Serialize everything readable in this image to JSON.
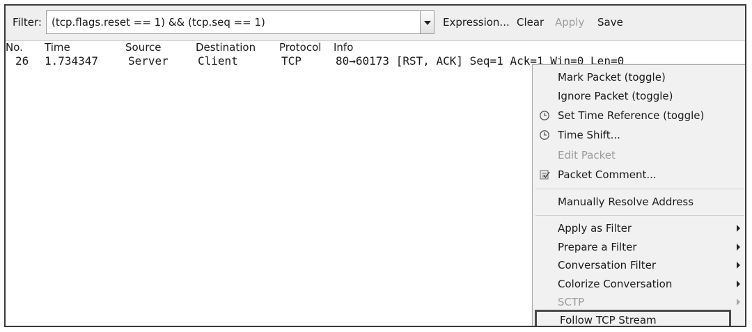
{
  "filter_bar": {
    "label": "Filter:",
    "value": "(tcp.flags.reset == 1) && (tcp.seq == 1)",
    "expression_button": "Expression...",
    "clear_button": "Clear",
    "apply_button": "Apply",
    "save_button": "Save"
  },
  "packet_list": {
    "columns": [
      "No.",
      "Time",
      "Source",
      "Destination",
      "Protocol",
      "Info"
    ],
    "rows": [
      {
        "no": "26",
        "time": "1.734347",
        "source": "Server",
        "destination": "Client",
        "protocol": "TCP",
        "info": "80→60173 [RST, ACK] Seq=1 Ack=1 Win=0 Len=0"
      }
    ]
  },
  "context_menu": {
    "items": [
      {
        "label": "Mark Packet (toggle)",
        "icon": "",
        "submenu": false,
        "enabled": true
      },
      {
        "label": "Ignore Packet (toggle)",
        "icon": "",
        "submenu": false,
        "enabled": true
      },
      {
        "label": "Set Time Reference (toggle)",
        "icon": "clock-icon",
        "submenu": false,
        "enabled": true
      },
      {
        "label": "Time Shift...",
        "icon": "clock-icon",
        "submenu": false,
        "enabled": true
      },
      {
        "label": "Edit Packet",
        "icon": "",
        "submenu": false,
        "enabled": false
      },
      {
        "label": "Packet Comment...",
        "icon": "comment-icon",
        "submenu": false,
        "enabled": true
      },
      {
        "label": "Manually Resolve Address",
        "icon": "",
        "submenu": false,
        "enabled": true
      },
      {
        "label": "Apply as Filter",
        "icon": "",
        "submenu": true,
        "enabled": true
      },
      {
        "label": "Prepare a Filter",
        "icon": "",
        "submenu": true,
        "enabled": true
      },
      {
        "label": "Conversation Filter",
        "icon": "",
        "submenu": true,
        "enabled": true
      },
      {
        "label": "Colorize Conversation",
        "icon": "",
        "submenu": true,
        "enabled": true
      },
      {
        "label": "SCTP",
        "icon": "",
        "submenu": true,
        "enabled": false
      },
      {
        "label": "Follow TCP Stream",
        "icon": "",
        "submenu": false,
        "enabled": true,
        "highlighted": true
      }
    ]
  }
}
